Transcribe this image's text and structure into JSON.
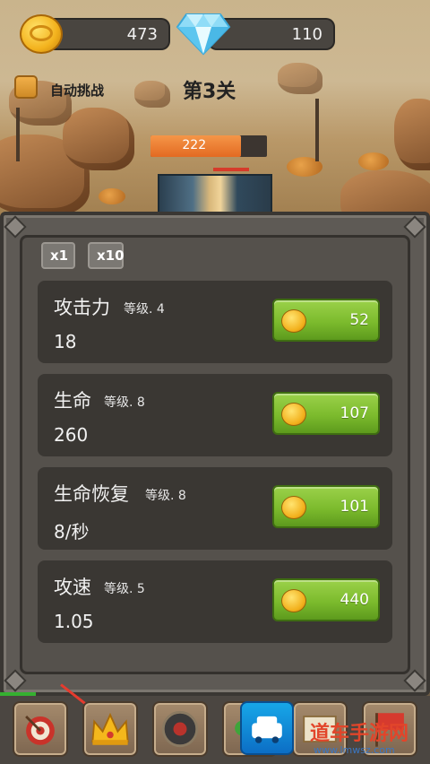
{
  "hud": {
    "coins": "473",
    "gems": "110",
    "auto_challenge_label": "自动挑战",
    "level_title": "第3关",
    "enemy_hp": "222",
    "enemy_hp_fraction": 0.78
  },
  "multipliers": [
    {
      "label": "x1",
      "selected": true
    },
    {
      "label": "x10",
      "selected": false
    }
  ],
  "stats": [
    {
      "name": "攻击力",
      "level": "等级. 4",
      "value": "18",
      "cost": "52"
    },
    {
      "name": "生命",
      "level": "等级. 8",
      "value": "260",
      "cost": "107"
    },
    {
      "name": "生命恢复",
      "level": "等级. 8",
      "value": "8/秒",
      "cost": "101"
    },
    {
      "name": "攻速",
      "level": "等级. 5",
      "value": "1.05",
      "cost": "440"
    }
  ],
  "bottom_nav": [
    {
      "icon": "target-icon"
    },
    {
      "icon": "crown-icon"
    },
    {
      "icon": "shield-icon"
    },
    {
      "icon": "clover-icon"
    },
    {
      "icon": "scroll-icon"
    },
    {
      "icon": "flag-icon"
    }
  ],
  "watermark": {
    "title": "道车手游网",
    "url": "www.lmwsz.com"
  },
  "colors": {
    "buy_green": "#7cbb2d",
    "coin_gold": "#f3b21d",
    "panel": "#5e5a55",
    "card": "#3a3733"
  }
}
